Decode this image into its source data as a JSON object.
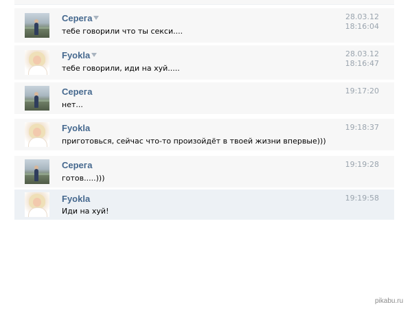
{
  "messages": [
    {
      "author": "Серега",
      "text": "тебе говорили что ты секси....",
      "date": "28.03.12",
      "time": "18:16:04",
      "avatar": "male-avatar",
      "caret": true
    },
    {
      "author": "Fyokla",
      "text": "тебе говорили, иди на хуй.....",
      "date": "28.03.12",
      "time": "18:16:47",
      "avatar": "female-avatar",
      "caret": true
    },
    {
      "author": "Серега",
      "text": "нет...",
      "date": "",
      "time": "19:17:20",
      "avatar": "male-avatar",
      "caret": false
    },
    {
      "author": "Fyokla",
      "text": "приготовься, сейчас что-то произойдёт в твоей жизни впервые)))",
      "date": "",
      "time": "19:18:37",
      "avatar": "female-avatar",
      "caret": false
    },
    {
      "author": "Серега",
      "text": "готов.....)))",
      "date": "",
      "time": "19:19:28",
      "avatar": "male-avatar",
      "caret": false
    },
    {
      "author": "Fyokla",
      "text": "Иди на хуй!",
      "date": "",
      "time": "19:19:58",
      "avatar": "female-avatar",
      "caret": false
    }
  ],
  "watermark": "pikabu.ru",
  "colors": {
    "author": "#45688e",
    "date": "#9aa4ae",
    "row": "#f7f7f7",
    "row_highlight": "#edf1f5"
  }
}
